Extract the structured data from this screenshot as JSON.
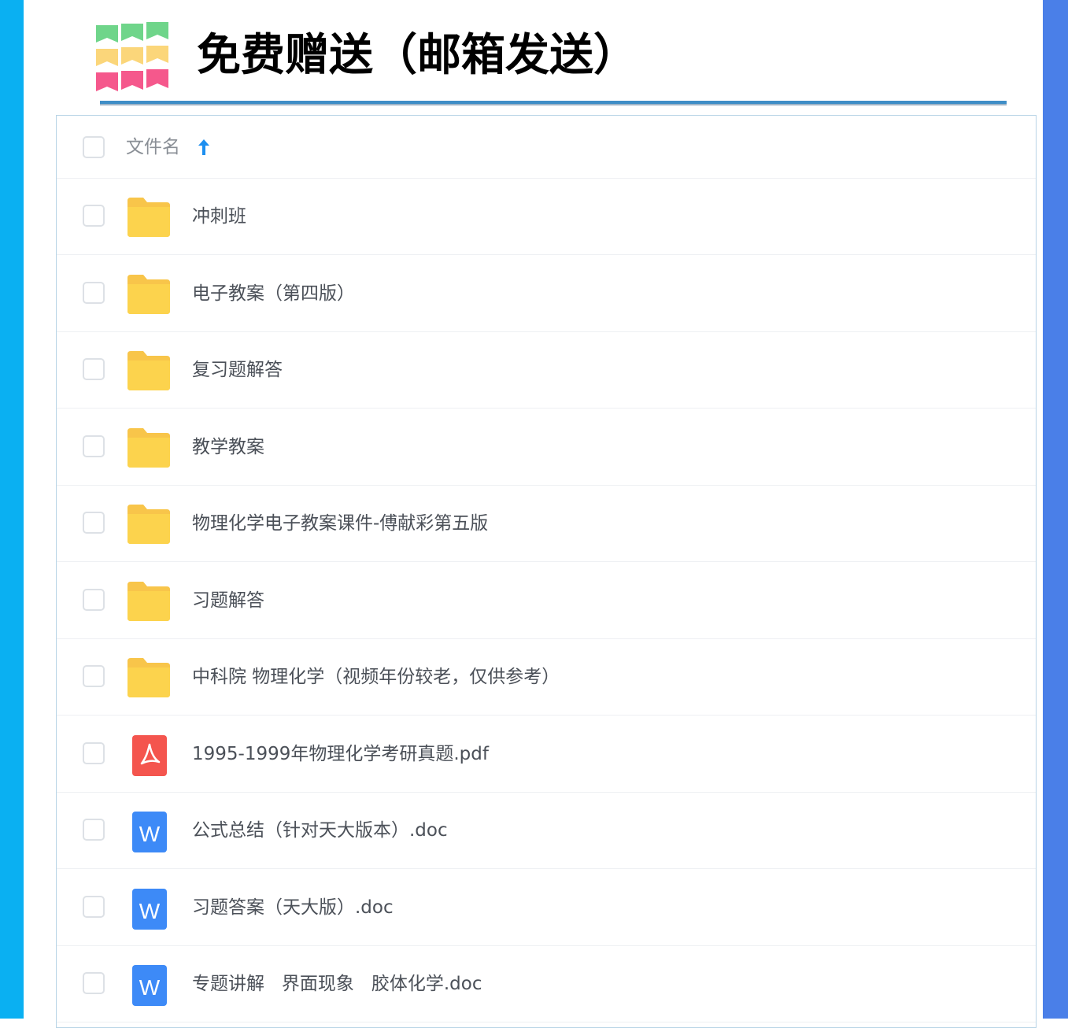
{
  "title": "免费赠送（邮箱发送）",
  "colors": {
    "left_bar": "#0ab0f2",
    "right_bar": "#4a7fe8",
    "rule": "#3f8ec7",
    "folder": "#fcd34d",
    "pdf": "#f4554e",
    "word": "#3d8af7"
  },
  "list_header": {
    "column_label": "文件名",
    "sort_icon": "arrow-up-icon"
  },
  "files": [
    {
      "name": "冲刺班",
      "type": "folder"
    },
    {
      "name": "电子教案（第四版）",
      "type": "folder"
    },
    {
      "name": "复习题解答",
      "type": "folder"
    },
    {
      "name": "教学教案",
      "type": "folder"
    },
    {
      "name": "物理化学电子教案课件-傅献彩第五版",
      "type": "folder"
    },
    {
      "name": "习题解答",
      "type": "folder"
    },
    {
      "name": "中科院 物理化学（视频年份较老，仅供参考）",
      "type": "folder"
    },
    {
      "name": "1995-1999年物理化学考研真题.pdf",
      "type": "pdf"
    },
    {
      "name": "公式总结（针对天大版本）.doc",
      "type": "doc"
    },
    {
      "name": "习题答案（天大版）.doc",
      "type": "doc"
    },
    {
      "name": "专题讲解   界面现象   胶体化学.doc",
      "type": "doc"
    }
  ]
}
